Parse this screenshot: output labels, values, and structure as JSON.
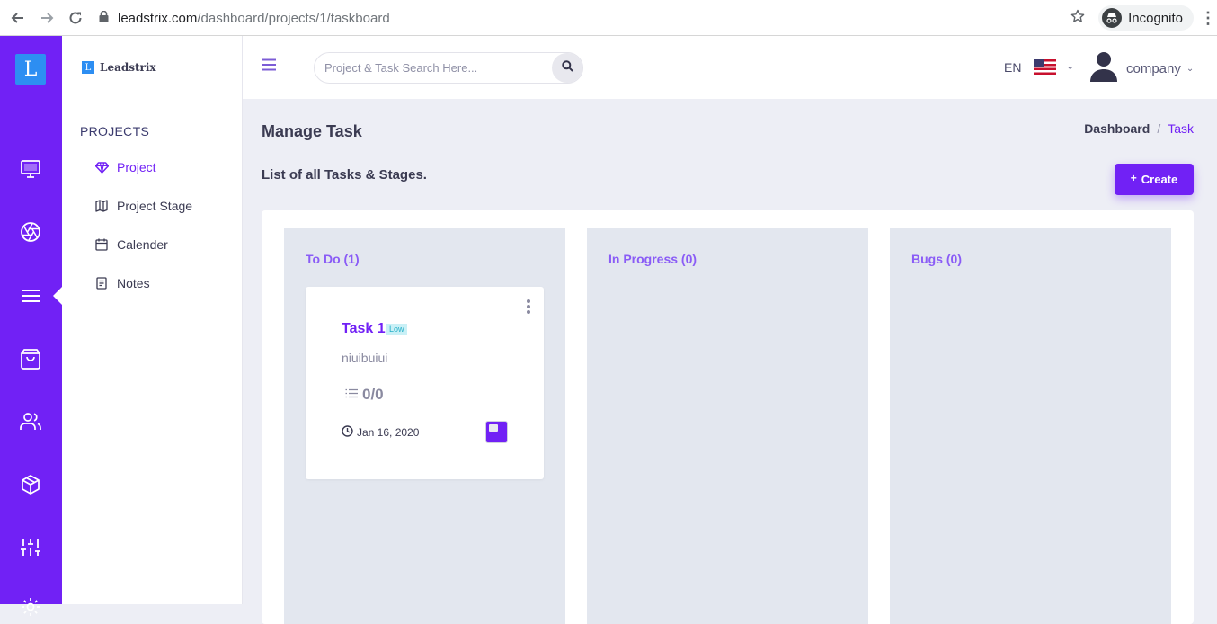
{
  "browser": {
    "url_domain": "leadstrix.com",
    "url_path": "/dashboard/projects/1/taskboard",
    "incognito_label": "Incognito"
  },
  "rail": {
    "logo_letter": "L"
  },
  "subnav": {
    "brand_letter": "L",
    "brand_name": "Leadstrix",
    "section": "PROJECTS",
    "items": [
      {
        "label": "Project",
        "icon": "diamond-icon",
        "active": true
      },
      {
        "label": "Project Stage",
        "icon": "map-icon",
        "active": false
      },
      {
        "label": "Calender",
        "icon": "calendar-icon",
        "active": false
      },
      {
        "label": "Notes",
        "icon": "notes-icon",
        "active": false
      }
    ]
  },
  "topbar": {
    "search_placeholder": "Project & Task Search Here...",
    "language": "EN",
    "user_name": "company"
  },
  "page": {
    "title": "Manage Task",
    "subtitle": "List of all Tasks & Stages.",
    "create_label": "Create",
    "breadcrumb": [
      "Dashboard",
      "Task"
    ]
  },
  "board": {
    "columns": [
      {
        "title": "To Do (1)",
        "cards": [
          {
            "title": "Task 1",
            "priority": "Low",
            "description": "niuibuiui",
            "checklist": "0/0",
            "date": "Jan 16, 2020"
          }
        ]
      },
      {
        "title": "In Progress (0)",
        "cards": []
      },
      {
        "title": "Bugs (0)",
        "cards": []
      }
    ]
  },
  "colors": {
    "brand": "#7121f5",
    "logo": "#2d8ef2",
    "column_bg": "#e3e7ef",
    "page_bg": "#edeef5"
  }
}
